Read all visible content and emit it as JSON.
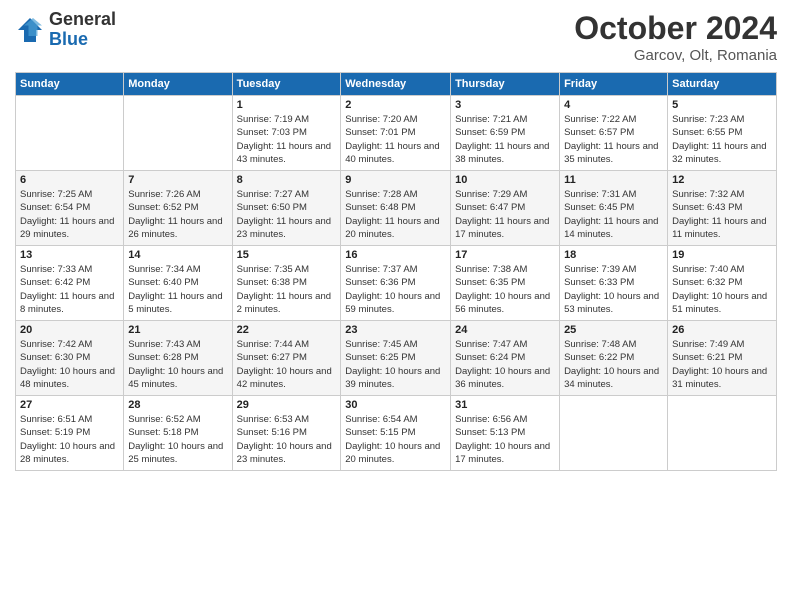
{
  "header": {
    "logo_line1": "General",
    "logo_line2": "Blue",
    "main_title": "October 2024",
    "subtitle": "Garcov, Olt, Romania"
  },
  "days_of_week": [
    "Sunday",
    "Monday",
    "Tuesday",
    "Wednesday",
    "Thursday",
    "Friday",
    "Saturday"
  ],
  "weeks": [
    [
      {
        "day": "",
        "sunrise": "",
        "sunset": "",
        "daylight": ""
      },
      {
        "day": "",
        "sunrise": "",
        "sunset": "",
        "daylight": ""
      },
      {
        "day": "1",
        "sunrise": "Sunrise: 7:19 AM",
        "sunset": "Sunset: 7:03 PM",
        "daylight": "Daylight: 11 hours and 43 minutes."
      },
      {
        "day": "2",
        "sunrise": "Sunrise: 7:20 AM",
        "sunset": "Sunset: 7:01 PM",
        "daylight": "Daylight: 11 hours and 40 minutes."
      },
      {
        "day": "3",
        "sunrise": "Sunrise: 7:21 AM",
        "sunset": "Sunset: 6:59 PM",
        "daylight": "Daylight: 11 hours and 38 minutes."
      },
      {
        "day": "4",
        "sunrise": "Sunrise: 7:22 AM",
        "sunset": "Sunset: 6:57 PM",
        "daylight": "Daylight: 11 hours and 35 minutes."
      },
      {
        "day": "5",
        "sunrise": "Sunrise: 7:23 AM",
        "sunset": "Sunset: 6:55 PM",
        "daylight": "Daylight: 11 hours and 32 minutes."
      }
    ],
    [
      {
        "day": "6",
        "sunrise": "Sunrise: 7:25 AM",
        "sunset": "Sunset: 6:54 PM",
        "daylight": "Daylight: 11 hours and 29 minutes."
      },
      {
        "day": "7",
        "sunrise": "Sunrise: 7:26 AM",
        "sunset": "Sunset: 6:52 PM",
        "daylight": "Daylight: 11 hours and 26 minutes."
      },
      {
        "day": "8",
        "sunrise": "Sunrise: 7:27 AM",
        "sunset": "Sunset: 6:50 PM",
        "daylight": "Daylight: 11 hours and 23 minutes."
      },
      {
        "day": "9",
        "sunrise": "Sunrise: 7:28 AM",
        "sunset": "Sunset: 6:48 PM",
        "daylight": "Daylight: 11 hours and 20 minutes."
      },
      {
        "day": "10",
        "sunrise": "Sunrise: 7:29 AM",
        "sunset": "Sunset: 6:47 PM",
        "daylight": "Daylight: 11 hours and 17 minutes."
      },
      {
        "day": "11",
        "sunrise": "Sunrise: 7:31 AM",
        "sunset": "Sunset: 6:45 PM",
        "daylight": "Daylight: 11 hours and 14 minutes."
      },
      {
        "day": "12",
        "sunrise": "Sunrise: 7:32 AM",
        "sunset": "Sunset: 6:43 PM",
        "daylight": "Daylight: 11 hours and 11 minutes."
      }
    ],
    [
      {
        "day": "13",
        "sunrise": "Sunrise: 7:33 AM",
        "sunset": "Sunset: 6:42 PM",
        "daylight": "Daylight: 11 hours and 8 minutes."
      },
      {
        "day": "14",
        "sunrise": "Sunrise: 7:34 AM",
        "sunset": "Sunset: 6:40 PM",
        "daylight": "Daylight: 11 hours and 5 minutes."
      },
      {
        "day": "15",
        "sunrise": "Sunrise: 7:35 AM",
        "sunset": "Sunset: 6:38 PM",
        "daylight": "Daylight: 11 hours and 2 minutes."
      },
      {
        "day": "16",
        "sunrise": "Sunrise: 7:37 AM",
        "sunset": "Sunset: 6:36 PM",
        "daylight": "Daylight: 10 hours and 59 minutes."
      },
      {
        "day": "17",
        "sunrise": "Sunrise: 7:38 AM",
        "sunset": "Sunset: 6:35 PM",
        "daylight": "Daylight: 10 hours and 56 minutes."
      },
      {
        "day": "18",
        "sunrise": "Sunrise: 7:39 AM",
        "sunset": "Sunset: 6:33 PM",
        "daylight": "Daylight: 10 hours and 53 minutes."
      },
      {
        "day": "19",
        "sunrise": "Sunrise: 7:40 AM",
        "sunset": "Sunset: 6:32 PM",
        "daylight": "Daylight: 10 hours and 51 minutes."
      }
    ],
    [
      {
        "day": "20",
        "sunrise": "Sunrise: 7:42 AM",
        "sunset": "Sunset: 6:30 PM",
        "daylight": "Daylight: 10 hours and 48 minutes."
      },
      {
        "day": "21",
        "sunrise": "Sunrise: 7:43 AM",
        "sunset": "Sunset: 6:28 PM",
        "daylight": "Daylight: 10 hours and 45 minutes."
      },
      {
        "day": "22",
        "sunrise": "Sunrise: 7:44 AM",
        "sunset": "Sunset: 6:27 PM",
        "daylight": "Daylight: 10 hours and 42 minutes."
      },
      {
        "day": "23",
        "sunrise": "Sunrise: 7:45 AM",
        "sunset": "Sunset: 6:25 PM",
        "daylight": "Daylight: 10 hours and 39 minutes."
      },
      {
        "day": "24",
        "sunrise": "Sunrise: 7:47 AM",
        "sunset": "Sunset: 6:24 PM",
        "daylight": "Daylight: 10 hours and 36 minutes."
      },
      {
        "day": "25",
        "sunrise": "Sunrise: 7:48 AM",
        "sunset": "Sunset: 6:22 PM",
        "daylight": "Daylight: 10 hours and 34 minutes."
      },
      {
        "day": "26",
        "sunrise": "Sunrise: 7:49 AM",
        "sunset": "Sunset: 6:21 PM",
        "daylight": "Daylight: 10 hours and 31 minutes."
      }
    ],
    [
      {
        "day": "27",
        "sunrise": "Sunrise: 6:51 AM",
        "sunset": "Sunset: 5:19 PM",
        "daylight": "Daylight: 10 hours and 28 minutes."
      },
      {
        "day": "28",
        "sunrise": "Sunrise: 6:52 AM",
        "sunset": "Sunset: 5:18 PM",
        "daylight": "Daylight: 10 hours and 25 minutes."
      },
      {
        "day": "29",
        "sunrise": "Sunrise: 6:53 AM",
        "sunset": "Sunset: 5:16 PM",
        "daylight": "Daylight: 10 hours and 23 minutes."
      },
      {
        "day": "30",
        "sunrise": "Sunrise: 6:54 AM",
        "sunset": "Sunset: 5:15 PM",
        "daylight": "Daylight: 10 hours and 20 minutes."
      },
      {
        "day": "31",
        "sunrise": "Sunrise: 6:56 AM",
        "sunset": "Sunset: 5:13 PM",
        "daylight": "Daylight: 10 hours and 17 minutes."
      },
      {
        "day": "",
        "sunrise": "",
        "sunset": "",
        "daylight": ""
      },
      {
        "day": "",
        "sunrise": "",
        "sunset": "",
        "daylight": ""
      }
    ]
  ]
}
